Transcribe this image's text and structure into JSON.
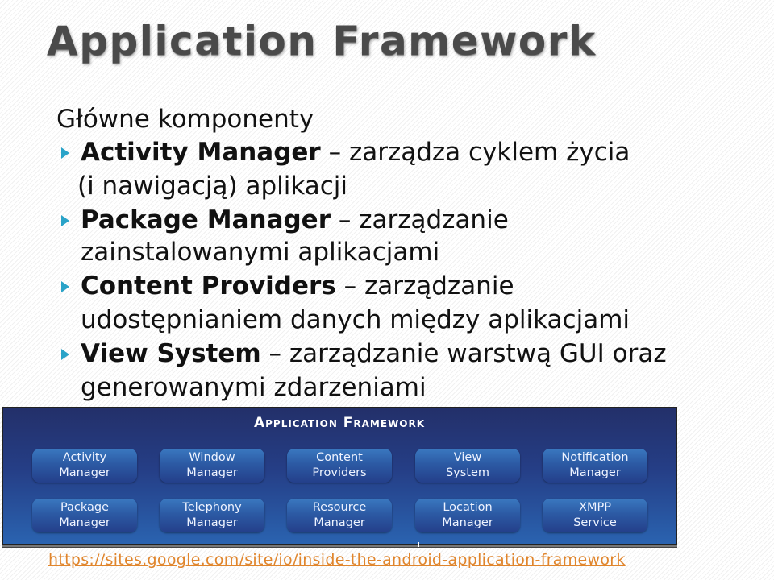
{
  "slide": {
    "title": "Application Framework",
    "intro": "Główne komponenty",
    "bullets": [
      {
        "term": "Activity Manager",
        "desc": " – zarządza cyklem życia",
        "continuation": "(i nawigacją) aplikacji"
      },
      {
        "term": "Package Manager",
        "desc": " – zarządzanie",
        "continuation": "zainstalowanymi aplikacjami"
      },
      {
        "term": "Content Providers",
        "desc": " – zarządzanie",
        "continuation": "udostępnianiem danych między aplikacjami"
      },
      {
        "term": "View System",
        "desc": " – zarządzanie warstwą GUI oraz",
        "continuation": "generowanymi zdarzeniami"
      }
    ],
    "bullet_color": "#2aa3c8",
    "link": "https://sites.google.com/site/io/inside-the-android-application-framework",
    "link_color": "#e0852c"
  },
  "diagram": {
    "title": "Application Framework",
    "rows": [
      [
        {
          "line1": "Activity",
          "line2": "Manager"
        },
        {
          "line1": "Window",
          "line2": "Manager"
        },
        {
          "line1": "Content",
          "line2": "Providers"
        },
        {
          "line1": "View",
          "line2": "System"
        },
        {
          "line1": "Notification",
          "line2": "Manager"
        }
      ],
      [
        {
          "line1": "Package",
          "line2": "Manager"
        },
        {
          "line1": "Telephony",
          "line2": "Manager"
        },
        {
          "line1": "Resource",
          "line2": "Manager"
        },
        {
          "line1": "Location",
          "line2": "Manager"
        },
        {
          "line1": "XMPP",
          "line2": "Service"
        }
      ]
    ]
  }
}
